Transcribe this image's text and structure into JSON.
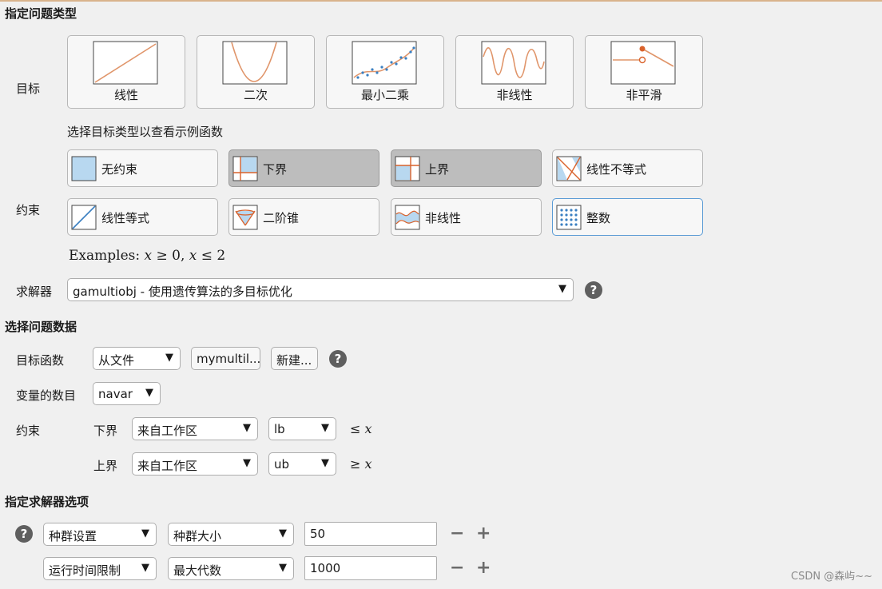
{
  "sections": {
    "problem_type": "指定问题类型",
    "problem_data": "选择问题数据",
    "solver_options": "指定求解器选项"
  },
  "objective": {
    "label": "目标",
    "hint": "选择目标类型以查看示例函数",
    "tiles": [
      {
        "label": "线性"
      },
      {
        "label": "二次"
      },
      {
        "label": "最小二乘"
      },
      {
        "label": "非线性"
      },
      {
        "label": "非平滑"
      }
    ]
  },
  "constraints": {
    "label": "约束",
    "buttons": [
      {
        "label": "无约束",
        "selected": false
      },
      {
        "label": "下界",
        "selected": true
      },
      {
        "label": "上界",
        "selected": true
      },
      {
        "label": "线性不等式",
        "selected": false
      },
      {
        "label": "线性等式",
        "selected": false
      },
      {
        "label": "二阶锥",
        "selected": false
      },
      {
        "label": "非线性",
        "selected": false
      },
      {
        "label": "整数",
        "selected": false
      }
    ],
    "examples": "Examples: 𝑥 ≥ 0, 𝑥 ≤ 2"
  },
  "solver": {
    "label": "求解器",
    "value": "gamultiobj - 使用遗传算法的多目标优化"
  },
  "data": {
    "objective_function": {
      "label": "目标函数",
      "source": "从文件",
      "file": "mymultil...",
      "new_button": "新建..."
    },
    "num_variables": {
      "label": "变量的数目",
      "value": "navar"
    },
    "constraints": {
      "label": "约束",
      "lower": {
        "label": "下界",
        "source": "来自工作区",
        "var": "lb",
        "relation": "≤ 𝑥"
      },
      "upper": {
        "label": "上界",
        "source": "来自工作区",
        "var": "ub",
        "relation": "≥ 𝑥"
      }
    }
  },
  "options": {
    "rows": [
      {
        "category": "种群设置",
        "option": "种群大小",
        "value": "50"
      },
      {
        "category": "运行时间限制",
        "option": "最大代数",
        "value": "1000"
      }
    ],
    "minus": "−",
    "plus": "+"
  },
  "icons": {
    "help": "?",
    "dropdown_arrow": "▼"
  },
  "watermark": "CSDN @森屿~~",
  "colors": {
    "plot_line": "#e0956a",
    "plot_marker": "#3a7fc1",
    "nonsmooth_marker": "#d9622b",
    "constraint_fill": "#b8d8f0",
    "selected_bg": "#bdbdbd"
  }
}
